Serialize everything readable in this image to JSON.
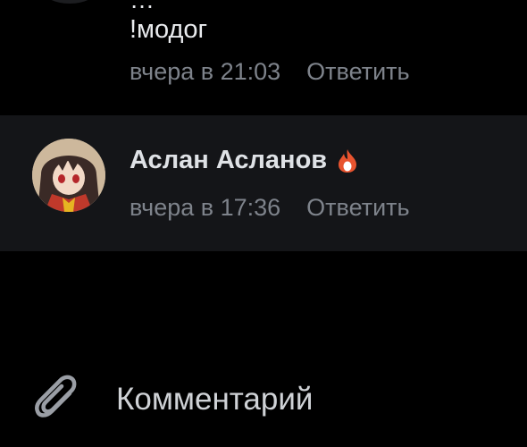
{
  "previous_comment": {
    "author_partial": "…",
    "text": "!модог",
    "time": "вчера в 21:03",
    "reply_label": "Ответить"
  },
  "highlighted_comment": {
    "author": "Аслан Асланов",
    "badge_icon": "flame-icon",
    "badge_color": "#e8542f",
    "time": "вчера в 17:36",
    "reply_label": "Ответить"
  },
  "composer": {
    "attach_icon": "paperclip-icon",
    "placeholder": "Комментарий"
  },
  "colors": {
    "background": "#000000",
    "highlight_row": "#141518",
    "primary_text": "#e9ebee",
    "secondary_text": "#7e838b"
  }
}
